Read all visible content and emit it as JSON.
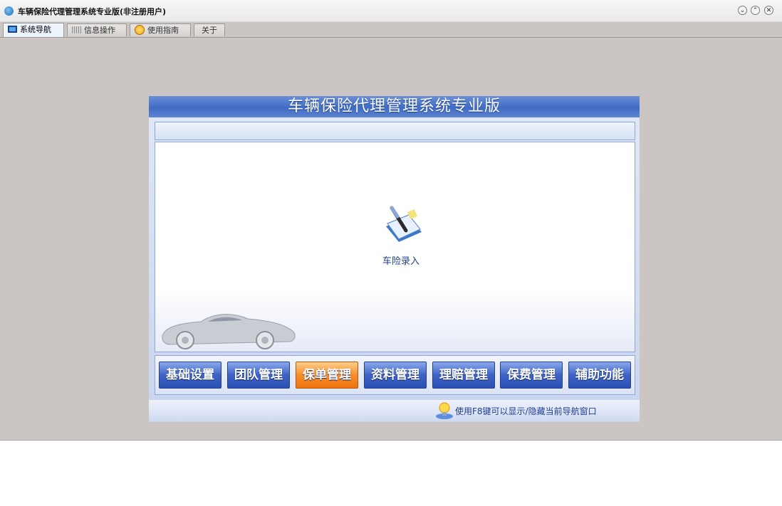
{
  "window": {
    "title": "车辆保险代理管理系统专业版(非注册用户)",
    "controls": [
      "minimize-icon",
      "maximize-icon",
      "close-icon"
    ]
  },
  "tabs": [
    {
      "label": "系统导航",
      "icon": "nav-icon",
      "active": true
    },
    {
      "label": "信息操作",
      "icon": "grid-icon",
      "active": false
    },
    {
      "label": "使用指南",
      "icon": "help-icon",
      "active": false
    },
    {
      "label": "关于",
      "icon": "",
      "active": false
    }
  ],
  "panel": {
    "title": "车辆保险代理管理系统专业版",
    "entry": {
      "label": "车险录入",
      "icon": "document-pen-icon"
    },
    "decor": "car-image"
  },
  "nav_buttons": [
    {
      "label": "基础设置",
      "selected": false
    },
    {
      "label": "团队管理",
      "selected": false
    },
    {
      "label": "保单管理",
      "selected": true
    },
    {
      "label": "资料管理",
      "selected": false
    },
    {
      "label": "理赔管理",
      "selected": false
    },
    {
      "label": "保费管理",
      "selected": false
    },
    {
      "label": "辅助功能",
      "selected": false
    }
  ],
  "hint": {
    "text": "使用F8键可以显示/隐藏当前导航窗口",
    "icon": "lightbulb-icon"
  },
  "colors": {
    "accent": "#3f6bc3",
    "selected": "#f58d2a",
    "window_bg": "#cbc6c3"
  }
}
